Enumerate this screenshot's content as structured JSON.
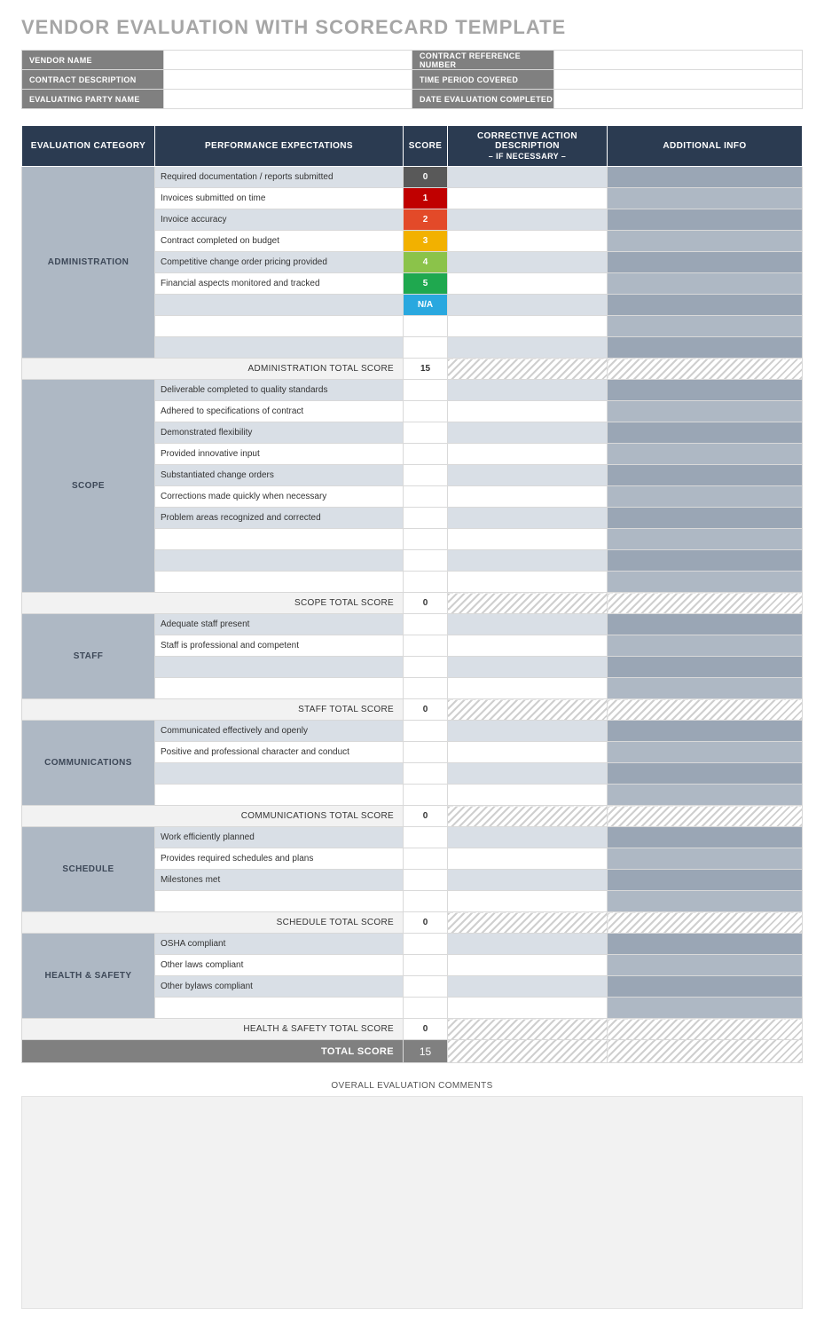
{
  "title": "VENDOR EVALUATION WITH SCORECARD TEMPLATE",
  "info": {
    "vendor_name_label": "VENDOR NAME",
    "vendor_name_value": "",
    "contract_ref_label": "CONTRACT REFERENCE NUMBER",
    "contract_ref_value": "",
    "contract_desc_label": "CONTRACT DESCRIPTION",
    "contract_desc_value": "",
    "time_period_label": "TIME PERIOD COVERED",
    "time_period_value": "",
    "eval_party_label": "EVALUATING PARTY NAME",
    "eval_party_value": "",
    "date_completed_label": "DATE EVALUATION COMPLETED",
    "date_completed_value": ""
  },
  "headers": {
    "category": "EVALUATION CATEGORY",
    "expectations": "PERFORMANCE EXPECTATIONS",
    "score": "SCORE",
    "corrective_line1": "CORRECTIVE ACTION DESCRIPTION",
    "corrective_line2": "– IF NECESSARY –",
    "additional": "ADDITIONAL INFO"
  },
  "sections": [
    {
      "name": "ADMINISTRATION",
      "rows": [
        {
          "exp": "Required documentation / reports submitted",
          "score": "0",
          "score_class": "sc0"
        },
        {
          "exp": "Invoices submitted on time",
          "score": "1",
          "score_class": "sc1"
        },
        {
          "exp": "Invoice accuracy",
          "score": "2",
          "score_class": "sc2"
        },
        {
          "exp": "Contract completed on budget",
          "score": "3",
          "score_class": "sc3"
        },
        {
          "exp": "Competitive change order pricing provided",
          "score": "4",
          "score_class": "sc4"
        },
        {
          "exp": "Financial aspects monitored and tracked",
          "score": "5",
          "score_class": "sc5"
        },
        {
          "exp": "",
          "score": "N/A",
          "score_class": "scNA"
        },
        {
          "exp": "",
          "score": "",
          "score_class": ""
        },
        {
          "exp": "",
          "score": "",
          "score_class": ""
        }
      ],
      "subtotal_label": "ADMINISTRATION TOTAL SCORE",
      "subtotal_value": "15"
    },
    {
      "name": "SCOPE",
      "rows": [
        {
          "exp": "Deliverable completed to quality standards",
          "score": "",
          "score_class": ""
        },
        {
          "exp": "Adhered to specifications of contract",
          "score": "",
          "score_class": ""
        },
        {
          "exp": "Demonstrated flexibility",
          "score": "",
          "score_class": ""
        },
        {
          "exp": "Provided innovative input",
          "score": "",
          "score_class": ""
        },
        {
          "exp": "Substantiated change orders",
          "score": "",
          "score_class": ""
        },
        {
          "exp": "Corrections made quickly when necessary",
          "score": "",
          "score_class": ""
        },
        {
          "exp": "Problem areas recognized and corrected",
          "score": "",
          "score_class": ""
        },
        {
          "exp": "",
          "score": "",
          "score_class": ""
        },
        {
          "exp": "",
          "score": "",
          "score_class": ""
        },
        {
          "exp": "",
          "score": "",
          "score_class": ""
        }
      ],
      "subtotal_label": "SCOPE TOTAL SCORE",
      "subtotal_value": "0"
    },
    {
      "name": "STAFF",
      "rows": [
        {
          "exp": "Adequate staff present",
          "score": "",
          "score_class": ""
        },
        {
          "exp": "Staff is professional and competent",
          "score": "",
          "score_class": ""
        },
        {
          "exp": "",
          "score": "",
          "score_class": ""
        },
        {
          "exp": "",
          "score": "",
          "score_class": ""
        }
      ],
      "subtotal_label": "STAFF TOTAL SCORE",
      "subtotal_value": "0"
    },
    {
      "name": "COMMUNICATIONS",
      "rows": [
        {
          "exp": "Communicated effectively and openly",
          "score": "",
          "score_class": ""
        },
        {
          "exp": "Positive and professional character and conduct",
          "score": "",
          "score_class": ""
        },
        {
          "exp": "",
          "score": "",
          "score_class": ""
        },
        {
          "exp": "",
          "score": "",
          "score_class": ""
        }
      ],
      "subtotal_label": "COMMUNICATIONS TOTAL SCORE",
      "subtotal_value": "0"
    },
    {
      "name": "SCHEDULE",
      "rows": [
        {
          "exp": "Work efficiently planned",
          "score": "",
          "score_class": ""
        },
        {
          "exp": "Provides required schedules and plans",
          "score": "",
          "score_class": ""
        },
        {
          "exp": "Milestones met",
          "score": "",
          "score_class": ""
        },
        {
          "exp": "",
          "score": "",
          "score_class": ""
        }
      ],
      "subtotal_label": "SCHEDULE TOTAL SCORE",
      "subtotal_value": "0"
    },
    {
      "name": "HEALTH & SAFETY",
      "rows": [
        {
          "exp": "OSHA compliant",
          "score": "",
          "score_class": ""
        },
        {
          "exp": "Other laws compliant",
          "score": "",
          "score_class": ""
        },
        {
          "exp": "Other bylaws compliant",
          "score": "",
          "score_class": ""
        },
        {
          "exp": "",
          "score": "",
          "score_class": ""
        }
      ],
      "subtotal_label": "HEALTH & SAFETY TOTAL SCORE",
      "subtotal_value": "0"
    }
  ],
  "grand_total_label": "TOTAL SCORE",
  "grand_total_value": "15",
  "comments_title": "OVERALL EVALUATION COMMENTS",
  "comments_value": ""
}
